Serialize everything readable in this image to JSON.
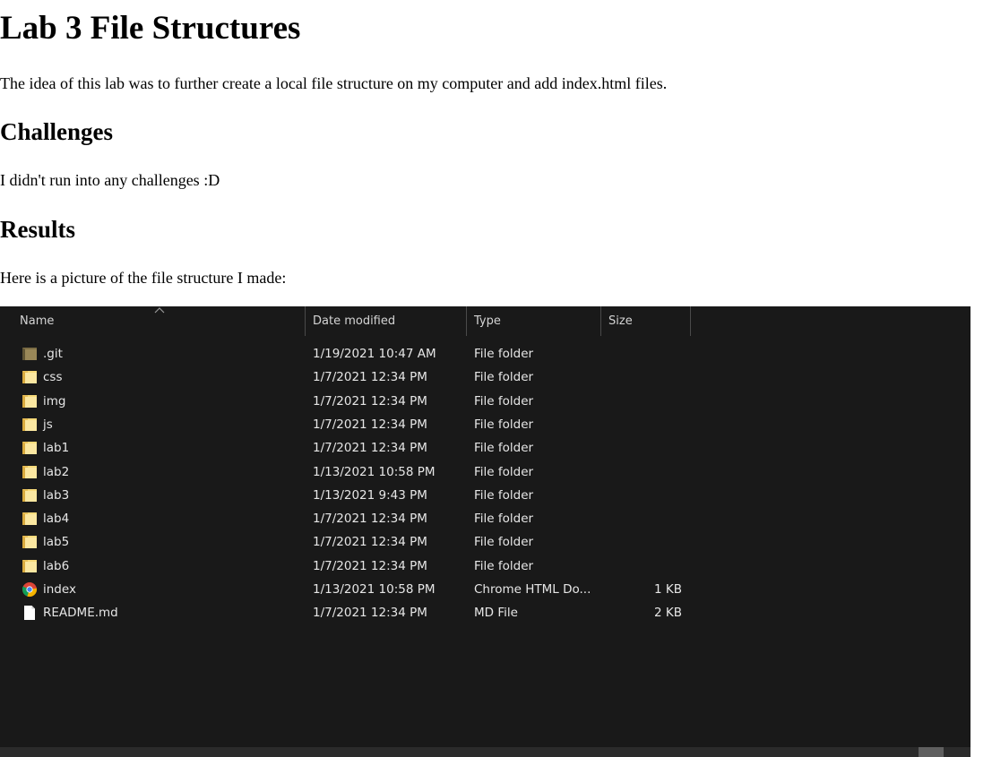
{
  "page": {
    "title": "Lab 3 File Structures",
    "intro": "The idea of this lab was to further create a local file structure on my computer and add index.html files.",
    "challenges_heading": "Challenges",
    "challenges_text": "I didn't run into any challenges :D",
    "results_heading": "Results",
    "results_text": "Here is a picture of the file structure I made:"
  },
  "explorer": {
    "columns": {
      "name": "Name",
      "date": "Date modified",
      "type": "Type",
      "size": "Size"
    },
    "rows": [
      {
        "name": ".git",
        "date": "1/19/2021 10:47 AM",
        "type": "File folder",
        "size": "",
        "icon": "git-folder-icon"
      },
      {
        "name": "css",
        "date": "1/7/2021 12:34 PM",
        "type": "File folder",
        "size": "",
        "icon": "folder-icon"
      },
      {
        "name": "img",
        "date": "1/7/2021 12:34 PM",
        "type": "File folder",
        "size": "",
        "icon": "folder-icon"
      },
      {
        "name": "js",
        "date": "1/7/2021 12:34 PM",
        "type": "File folder",
        "size": "",
        "icon": "folder-icon"
      },
      {
        "name": "lab1",
        "date": "1/7/2021 12:34 PM",
        "type": "File folder",
        "size": "",
        "icon": "folder-icon"
      },
      {
        "name": "lab2",
        "date": "1/13/2021 10:58 PM",
        "type": "File folder",
        "size": "",
        "icon": "folder-icon"
      },
      {
        "name": "lab3",
        "date": "1/13/2021 9:43 PM",
        "type": "File folder",
        "size": "",
        "icon": "folder-icon"
      },
      {
        "name": "lab4",
        "date": "1/7/2021 12:34 PM",
        "type": "File folder",
        "size": "",
        "icon": "folder-icon"
      },
      {
        "name": "lab5",
        "date": "1/7/2021 12:34 PM",
        "type": "File folder",
        "size": "",
        "icon": "folder-icon"
      },
      {
        "name": "lab6",
        "date": "1/7/2021 12:34 PM",
        "type": "File folder",
        "size": "",
        "icon": "folder-icon"
      },
      {
        "name": "index",
        "date": "1/13/2021 10:58 PM",
        "type": "Chrome HTML Do...",
        "size": "1 KB",
        "icon": "chrome-icon"
      },
      {
        "name": "README.md",
        "date": "1/7/2021 12:34 PM",
        "type": "MD File",
        "size": "2 KB",
        "icon": "file-icon"
      }
    ],
    "colors": {
      "background": "#191919",
      "folder": "#f5d36b",
      "git_folder": "#8a7a4d"
    }
  }
}
